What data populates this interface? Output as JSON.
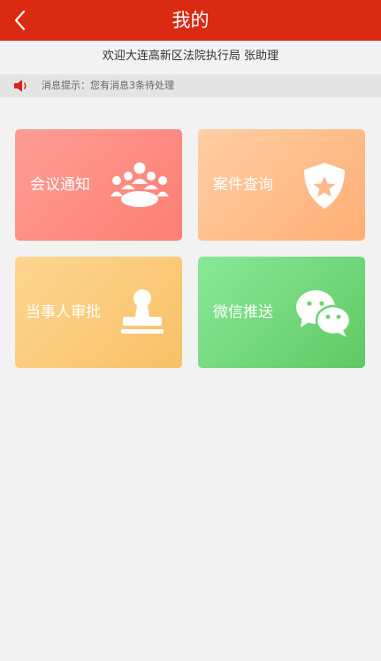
{
  "header": {
    "title": "我的"
  },
  "welcome": {
    "text": "欢迎大连高新区法院执行局 张助理"
  },
  "notice": {
    "text": "消息提示：您有消息3条待处理"
  },
  "tiles": [
    {
      "label": "会议通知",
      "icon": "group-icon"
    },
    {
      "label": "案件查询",
      "icon": "shield-star-icon"
    },
    {
      "label": "当事人审批",
      "icon": "stamp-icon"
    },
    {
      "label": "微信推送",
      "icon": "wechat-icon"
    }
  ],
  "colors": {
    "header": "#da2a12",
    "tile_meeting": "#fe8a80",
    "tile_case": "#ffbc88",
    "tile_approval": "#fbc977",
    "tile_wechat": "#71d87b"
  }
}
